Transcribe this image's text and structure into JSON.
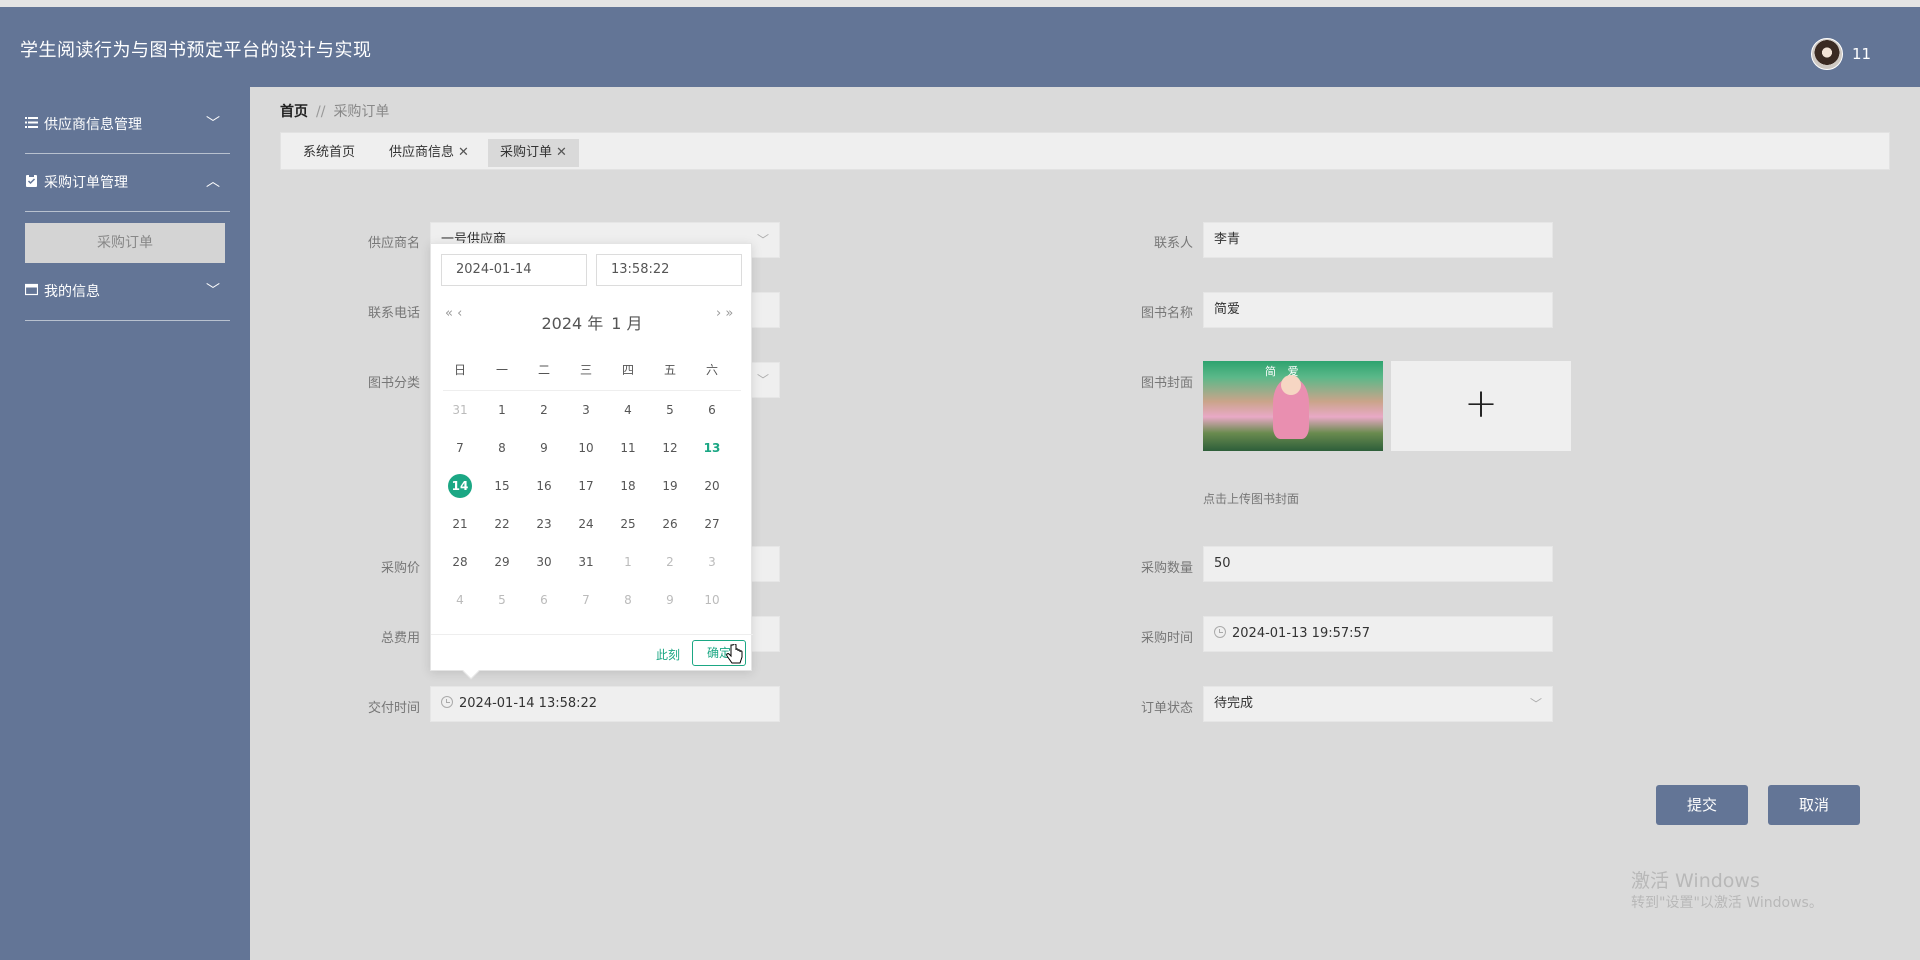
{
  "app": {
    "title": "学生阅读行为与图书预定平台的设计与实现",
    "user": "11"
  },
  "sidebar": {
    "items": [
      {
        "label": "供应商信息管理",
        "icon": "list-icon",
        "chevron": "﹀"
      },
      {
        "label": "采购订单管理",
        "icon": "clipboard-icon",
        "chevron": "︿"
      },
      {
        "label": "我的信息",
        "icon": "card-icon",
        "chevron": "﹀"
      }
    ],
    "sub_item": "采购订单"
  },
  "breadcrumb": {
    "home": "首页",
    "sep": "//",
    "current": "采购订单"
  },
  "tabs": [
    {
      "label": "系统首页"
    },
    {
      "label": "供应商信息",
      "close": "✕"
    },
    {
      "label": "采购订单",
      "close": "✕"
    }
  ],
  "form": {
    "supplier_label": "供应商名",
    "supplier_value": "一号供应商",
    "phone_label": "联系电话",
    "category_label": "图书分类",
    "price_label": "采购价",
    "total_label": "总费用",
    "delivery_label": "交付时间",
    "delivery_value": "2024-01-14 13:58:22",
    "contact_label": "联系人",
    "contact_value": "李青",
    "book_label": "图书名称",
    "book_value": "简爱",
    "cover_label": "图书封面",
    "cover_hint": "点击上传图书封面",
    "cover_title": "简 爱",
    "qty_label": "采购数量",
    "qty_value": "50",
    "time_label": "采购时间",
    "time_value": "2024-01-13 19:57:57",
    "status_label": "订单状态",
    "status_value": "待完成"
  },
  "buttons": {
    "submit": "提交",
    "cancel": "取消"
  },
  "picker": {
    "date_input": "2024-01-14",
    "time_input": "13:58:22",
    "year": "2024 年",
    "month": "1 月",
    "nav_prev": "« ‹",
    "nav_next": "› »",
    "weekdays": [
      "日",
      "一",
      "二",
      "三",
      "四",
      "五",
      "六"
    ],
    "days": [
      [
        "31",
        "1",
        "2",
        "3",
        "4",
        "5",
        "6"
      ],
      [
        "7",
        "8",
        "9",
        "10",
        "11",
        "12",
        "13"
      ],
      [
        "14",
        "15",
        "16",
        "17",
        "18",
        "19",
        "20"
      ],
      [
        "21",
        "22",
        "23",
        "24",
        "25",
        "26",
        "27"
      ],
      [
        "28",
        "29",
        "30",
        "31",
        "1",
        "2",
        "3"
      ],
      [
        "4",
        "5",
        "6",
        "7",
        "8",
        "9",
        "10"
      ]
    ],
    "now_label": "此刻",
    "confirm_label": "确定"
  },
  "watermark": {
    "line1": "激活 Windows",
    "line2": "转到\"设置\"以激活 Windows。"
  },
  "colors": {
    "primary": "#637596",
    "accent": "#1ba784"
  }
}
